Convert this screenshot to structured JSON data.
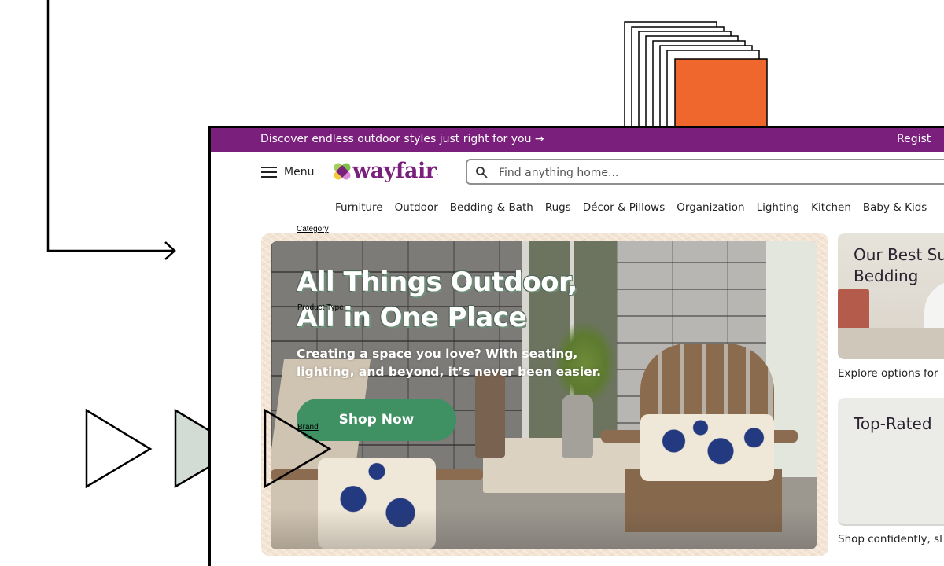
{
  "promo_bar": {
    "text": "Discover endless outdoor styles just right for you →",
    "right_text": "Regist"
  },
  "header": {
    "menu_label": "Menu",
    "logo_text": "wayfair",
    "logo_tm": "·",
    "search_placeholder": "Find anything home..."
  },
  "nav": {
    "items": [
      "Furniture",
      "Outdoor",
      "Bedding & Bath",
      "Rugs",
      "Décor & Pillows",
      "Organization",
      "Lighting",
      "Kitchen",
      "Baby & Kids"
    ]
  },
  "annotations": {
    "category": "Category",
    "product_type": "Product Type",
    "brand": "Brand"
  },
  "hero": {
    "title_line1": "All Things Outdoor,",
    "title_line2": "All in One Place",
    "subtitle_line1": "Creating a space you love? With seating,",
    "subtitle_line2": "lighting, and beyond, it’s never been easier.",
    "button_label": "Shop Now"
  },
  "cards": [
    {
      "title_line1": "Our Best Su",
      "title_line2": "Bedding",
      "caption": "Explore options for"
    },
    {
      "title_line1": "Top-Rated",
      "caption": "Shop confidently, sl"
    }
  ],
  "colors": {
    "brand_purple": "#7b1f7c",
    "button_green": "#3f9063",
    "accent_orange": "#f0672e",
    "triangle_fill": "#d3dcd4"
  }
}
